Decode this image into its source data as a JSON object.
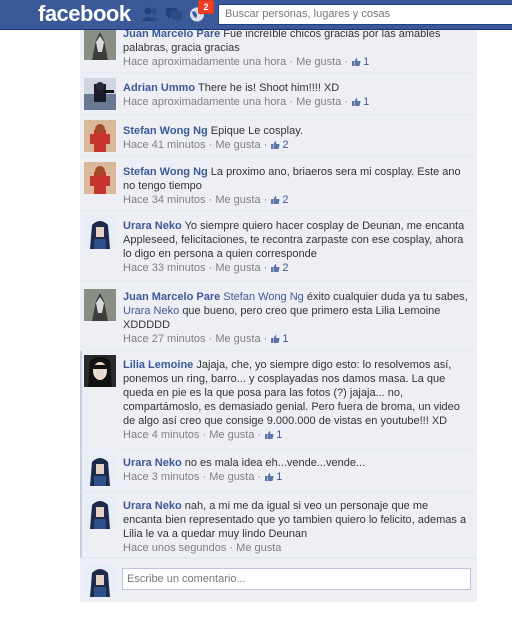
{
  "header": {
    "logo": "facebook",
    "notification_count": "2",
    "search_placeholder": "Buscar personas, lugares y cosas"
  },
  "comments": [
    {
      "author": "Juan Marcelo Pare",
      "text": "Fue increíble chicos gracias por las amables palabras, gracia gracias",
      "time": "Hace aproximadamente una hora",
      "like_label": "Me gusta",
      "likes": "1"
    },
    {
      "author": "Adrian Ummo",
      "text": "There he is! Shoot him!!!! XD",
      "time": "Hace aproximadamente una hora",
      "like_label": "Me gusta",
      "likes": "1"
    },
    {
      "author": "Stefan Wong Ng",
      "text": "Epique Le cosplay.",
      "time": "Hace 41 minutos",
      "like_label": "Me gusta",
      "likes": "2"
    },
    {
      "author": "Stefan Wong Ng",
      "text": "La proximo ano, briaeros sera mi cosplay. Este ano no tengo tiempo",
      "time": "Hace 34 minutos",
      "like_label": "Me gusta",
      "likes": "2"
    },
    {
      "author": "Urara Neko",
      "text": "Yo siempre quiero hacer cosplay de Deunan, me encanta Appleseed, felicitaciones, te recontra zarpaste con ese cosplay, ahora lo digo en persona a quien corresponde",
      "time": "Hace 33 minutos",
      "like_label": "Me gusta",
      "likes": "2"
    },
    {
      "author": "Juan Marcelo Pare",
      "mention1": "Stefan Wong Ng",
      "text1": "éxito cualquier duda ya tu sabes,",
      "mention2": "Urara Neko",
      "text2": "que bueno, pero creo que primero esta Lilia Lemoine XDDDDD",
      "time": "Hace 27 minutos",
      "like_label": "Me gusta",
      "likes": "1"
    },
    {
      "author": "Lilia Lemoine",
      "text": "Jajaja, che, yo siempre digo esto: lo resolvemos así, ponemos un ring, barro... y cosplayadas nos damos masa. La que queda en pie es la que posa para las fotos (?) jajaja... no, compartámoslo, es demasiado genial. Pero fuera de broma, un video de algo así creo que consige 9.000.000 de vistas en youtube!!! XD",
      "time": "Hace 4 minutos",
      "like_label": "Me gusta",
      "likes": "1"
    },
    {
      "author": "Urara Neko",
      "text": "no es mala idea eh...vende...vende...",
      "time": "Hace 3 minutos",
      "like_label": "Me gusta",
      "likes": "1"
    },
    {
      "author": "Urara Neko",
      "text": "nah, a mi me da igual si veo un personaje que me encanta bien representado que yo tambien quiero lo felicito, ademas a Lilia le va a quedar muy lindo Deunan",
      "time": "Hace unos segundos",
      "like_label": "Me gusta"
    }
  ],
  "composer": {
    "placeholder": "Escribe un comentario..."
  },
  "colors": {
    "brand": "#3b5998",
    "feed_bg": "#edeff4",
    "badge": "#f03d25"
  },
  "icons": [
    "friend-requests-icon",
    "messages-icon",
    "notifications-globe-icon",
    "like-thumb-icon"
  ]
}
